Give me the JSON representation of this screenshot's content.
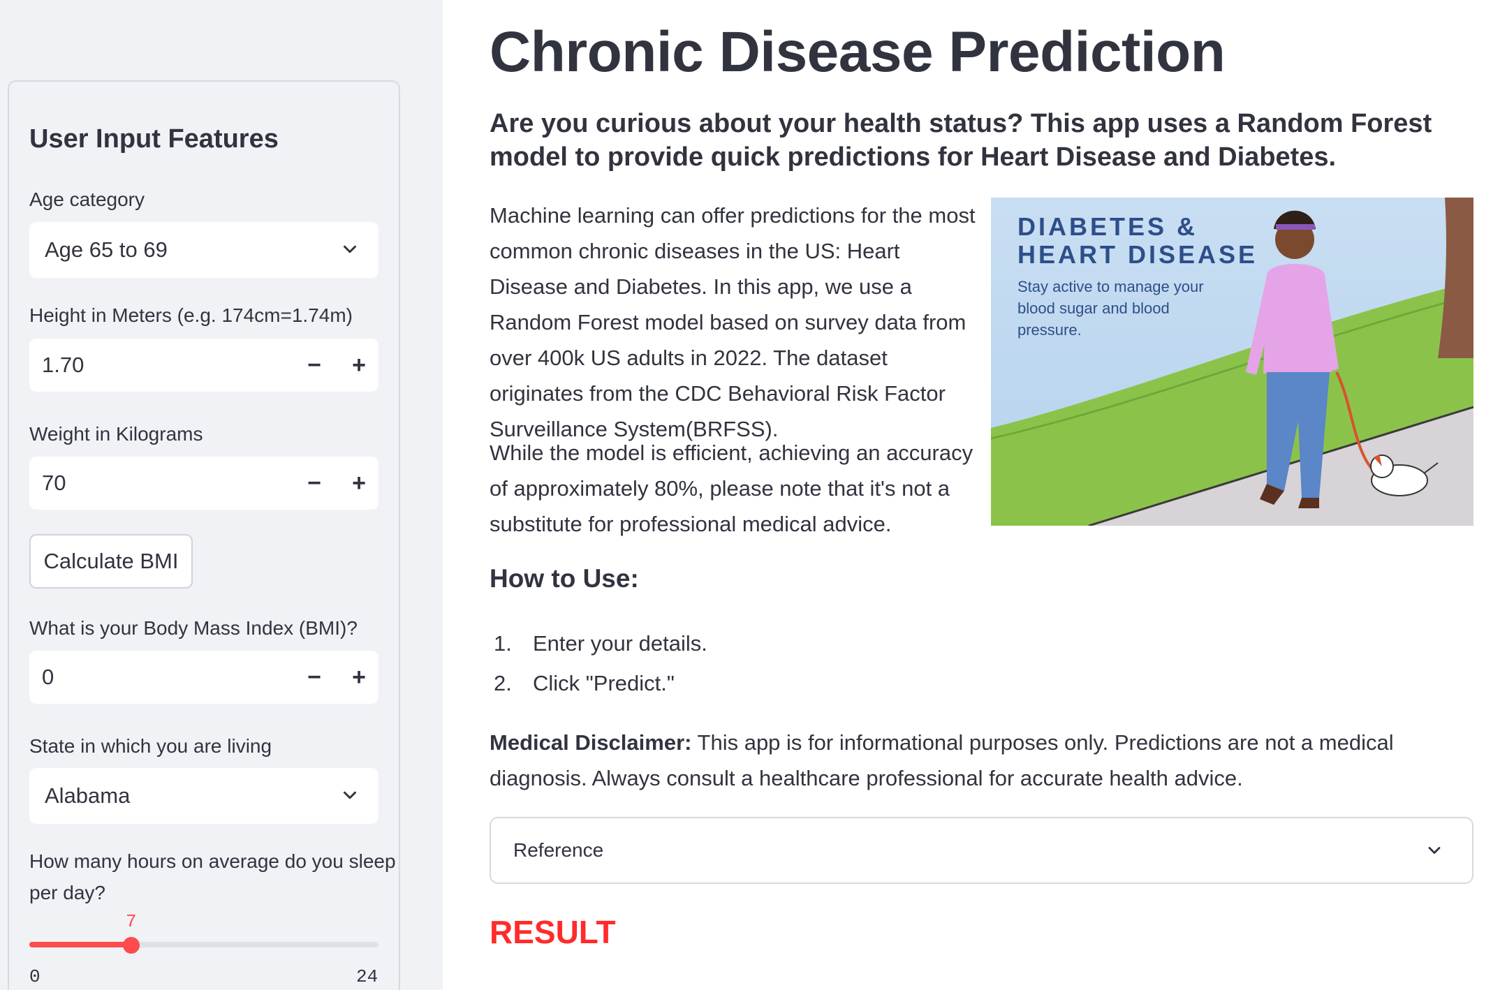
{
  "sidebar": {
    "title": "User Input Features",
    "age": {
      "label": "Age category",
      "value": "Age 65 to 69"
    },
    "height": {
      "label": "Height in Meters (e.g. 174cm=1.74m)",
      "value": "1.70"
    },
    "weight": {
      "label": "Weight in Kilograms",
      "value": "70"
    },
    "bmi_button": "Calculate BMI",
    "bmi": {
      "label": "What is your Body Mass Index (BMI)?",
      "value": "0"
    },
    "state": {
      "label": "State in which you are living",
      "value": "Alabama"
    },
    "sleep": {
      "label_line1": "How many hours on average do you sleep",
      "label_line2": "per day?",
      "value": 7,
      "value_text": "7",
      "min": 0,
      "max": 24,
      "min_text": "0",
      "max_text": "24"
    },
    "stepper_minus": "−",
    "stepper_plus": "+"
  },
  "main": {
    "title": "Chronic Disease Prediction",
    "subtitle": "Are you curious about your health status? This app uses a Random Forest model to provide quick predictions for Heart Disease and Diabetes.",
    "para1": "Machine learning can offer predictions for the most common chronic diseases in the US: Heart Disease and Diabetes. In this app, we use a Random Forest model based on survey data from over 400k US adults in 2022. The dataset originates from the CDC Behavioral Risk Factor Surveillance System(BRFSS).",
    "para2": "While the model is efficient, achieving an accuracy of approximately 80%, please note that it's not a substitute for professional medical advice.",
    "hero": {
      "title_line1": "DIABETES &",
      "title_line2": "HEART DISEASE",
      "subtitle": "Stay active to manage your blood sugar and blood pressure."
    },
    "how_to_title": "How to Use:",
    "steps": [
      {
        "num": "1.",
        "text": "Enter your details."
      },
      {
        "num": "2.",
        "text": "Click \"Predict.\""
      }
    ],
    "disclaimer_label": "Medical Disclaimer:",
    "disclaimer_text": " This app is for informational purposes only. Predictions are not a medical diagnosis. Always consult a healthcare professional for accurate health advice.",
    "reference_label": "Reference",
    "result_label": "RESULT"
  },
  "colors": {
    "accent": "#ff4b4b",
    "sidebar_bg": "#f0f2f6",
    "text": "#31333f",
    "hero_title": "#2d4e8a"
  }
}
